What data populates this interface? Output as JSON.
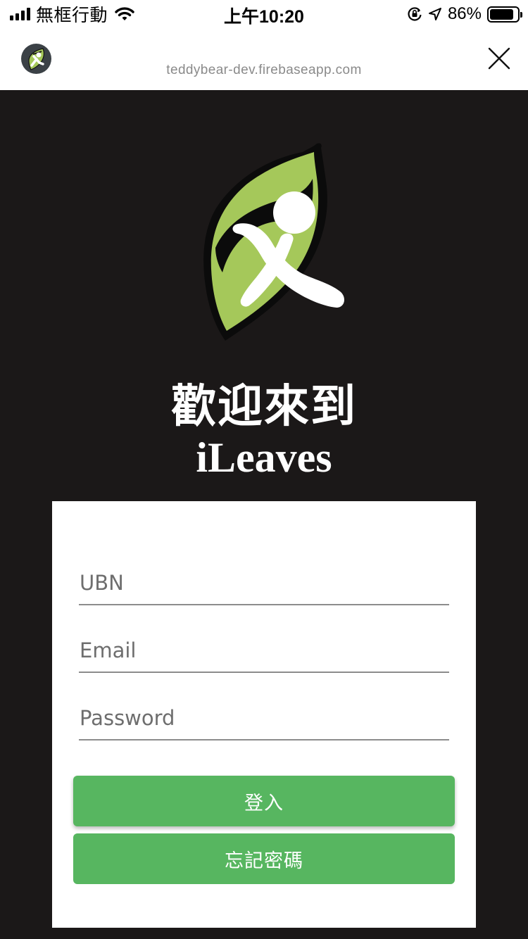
{
  "status_bar": {
    "carrier": "無框行動",
    "time": "上午10:20",
    "battery": "86%",
    "battery_level": 0.86,
    "icons": [
      "signal-icon",
      "wifi-icon",
      "orientation-lock-icon",
      "location-icon",
      "battery-icon"
    ]
  },
  "browser": {
    "url": "teddybear-dev.firebaseapp.com",
    "favicon": "ileaves-logo-icon",
    "close_icon": "close-icon"
  },
  "hero": {
    "welcome": "歡迎來到",
    "brand": "iLeaves",
    "logo": "ileaves-logo"
  },
  "login_form": {
    "ubn_placeholder": "UBN",
    "email_placeholder": "Email",
    "password_placeholder": "Password",
    "login_label": "登入",
    "forgot_label": "忘記密碼"
  },
  "colors": {
    "background": "#1b1818",
    "card": "#ffffff",
    "button": "#57b660",
    "leaf": "#a5c85a"
  }
}
